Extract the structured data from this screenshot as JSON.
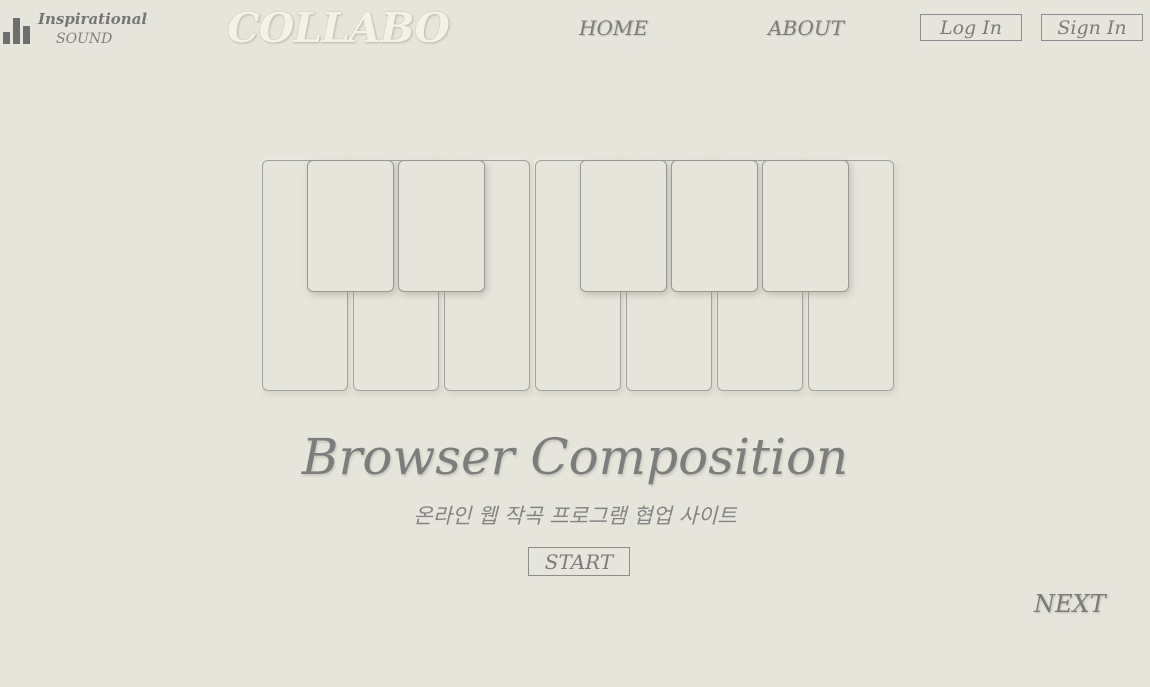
{
  "logo": {
    "icon": "bar-chart-icon",
    "line1": "Inspirational",
    "line2": "SOUND"
  },
  "header": {
    "brand": "COLLABO",
    "nav": {
      "home": "HOME",
      "about": "ABOUT"
    },
    "login_label": "Log In",
    "signin_label": "Sign In"
  },
  "piano": {
    "white_keys": 7,
    "black_keys": 5
  },
  "hero": {
    "title": "Browser Composition",
    "subtitle": "온라인 웹 작곡 프로그램 협업 사이트",
    "start_label": "START"
  },
  "footer": {
    "next_label": "NEXT"
  },
  "colors": {
    "background": "#e6e5db",
    "text": "#7f7f7f",
    "brand": "#f4f2e8",
    "border": "#8d8d8d"
  }
}
